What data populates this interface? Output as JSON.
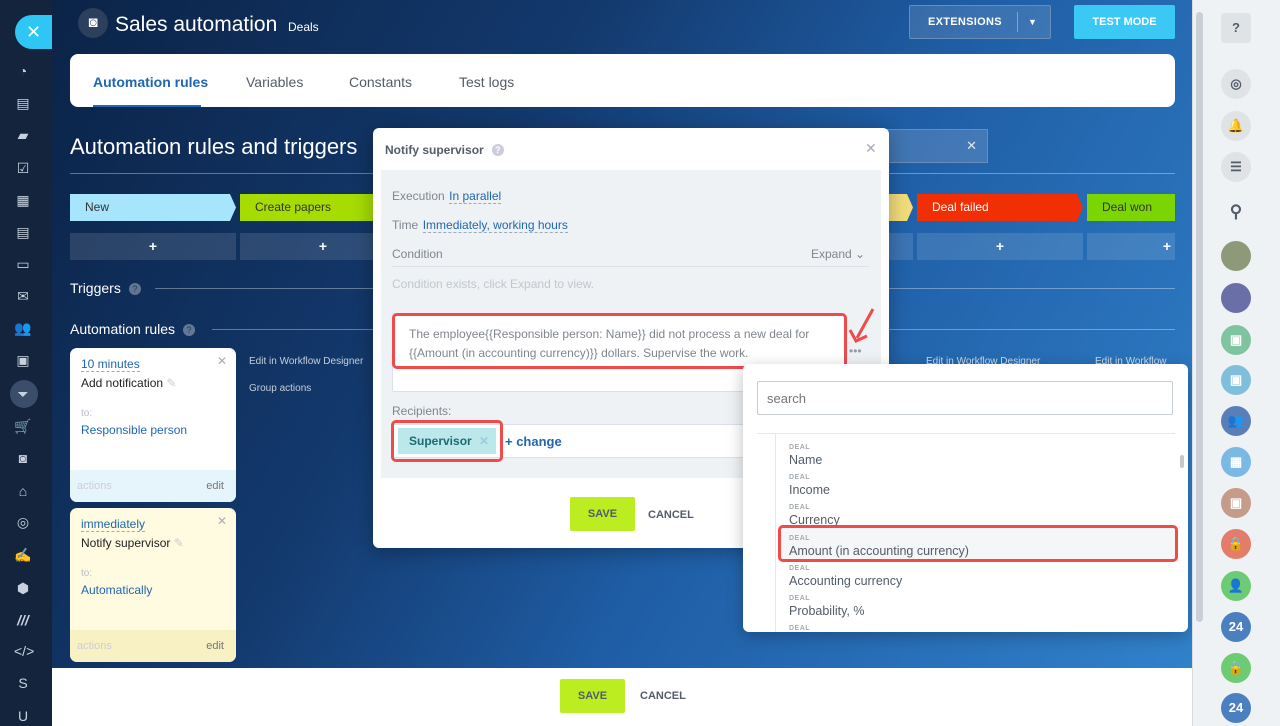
{
  "header": {
    "title": "Sales automation",
    "breadcrumb": "Deals",
    "extensions_label": "EXTENSIONS",
    "test_mode_label": "TEST MODE"
  },
  "tabs": [
    {
      "label": "Automation rules",
      "active": true
    },
    {
      "label": "Variables"
    },
    {
      "label": "Constants"
    },
    {
      "label": "Test logs"
    }
  ],
  "page_title": "Automation rules and triggers",
  "stages": [
    {
      "label": "New",
      "color": "#a6e5fb"
    },
    {
      "label": "Create papers",
      "color": "#a6dc00"
    },
    {
      "label": "",
      "color": "#f3dc7a"
    },
    {
      "label": "Deal failed",
      "color": "#f12e04"
    },
    {
      "label": "Deal won",
      "color": "#7bd500"
    }
  ],
  "add_symbol": "+",
  "sections": {
    "triggers": "Triggers",
    "automation_rules": "Automation rules"
  },
  "column_links": {
    "edit_designer": "Edit in Workflow Designer",
    "group_actions": "Group actions",
    "edit_designer_2": "Edit in Workflow Designer",
    "edit_designer_3": "Edit in Workflow"
  },
  "cards": [
    {
      "time": "10 minutes",
      "name": "Add notification",
      "to_label": "to:",
      "recipient": "Responsible person",
      "actions": "actions",
      "edit": "edit"
    },
    {
      "time": "immediately",
      "name": "Notify supervisor",
      "to_label": "to:",
      "recipient": "Automatically",
      "actions": "actions",
      "edit": "edit"
    }
  ],
  "modal": {
    "title": "Notify supervisor",
    "execution_label": "Execution",
    "execution_value": "In parallel",
    "time_label": "Time",
    "time_value": "Immediately, working hours",
    "condition_label": "Condition",
    "expand_label": "Expand",
    "condition_hint": "Condition exists, click Expand to view.",
    "message": "The employee{{Responsible person: Name}} did not process a new deal for {{Amount (in accounting currency)}} dollars. Supervise the work.",
    "recipients_label": "Recipients:",
    "recipient_tag": "Supervisor",
    "change_label": "+ change",
    "save": "SAVE",
    "cancel": "CANCEL"
  },
  "field_picker": {
    "search_placeholder": "search",
    "items": [
      {
        "category": "DEAL",
        "label": "Name"
      },
      {
        "category": "DEAL",
        "label": "Income"
      },
      {
        "category": "DEAL",
        "label": "Currency"
      },
      {
        "category": "DEAL",
        "label": "Amount (in accounting currency)",
        "highlighted": true
      },
      {
        "category": "DEAL",
        "label": "Accounting currency"
      },
      {
        "category": "DEAL",
        "label": "Probability, %"
      },
      {
        "category": "DEAL",
        "label": ""
      }
    ]
  },
  "footer": {
    "save": "SAVE",
    "cancel": "CANCEL"
  },
  "left_sidebar": {
    "letters": [
      "S",
      "U"
    ]
  },
  "right_sidebar": {
    "badges": [
      "24",
      "24"
    ]
  },
  "colors": {
    "accent": "#2067b0",
    "highlight": "#ee4b4b",
    "save": "#bbed21",
    "test_mode": "#3bc8f5"
  }
}
